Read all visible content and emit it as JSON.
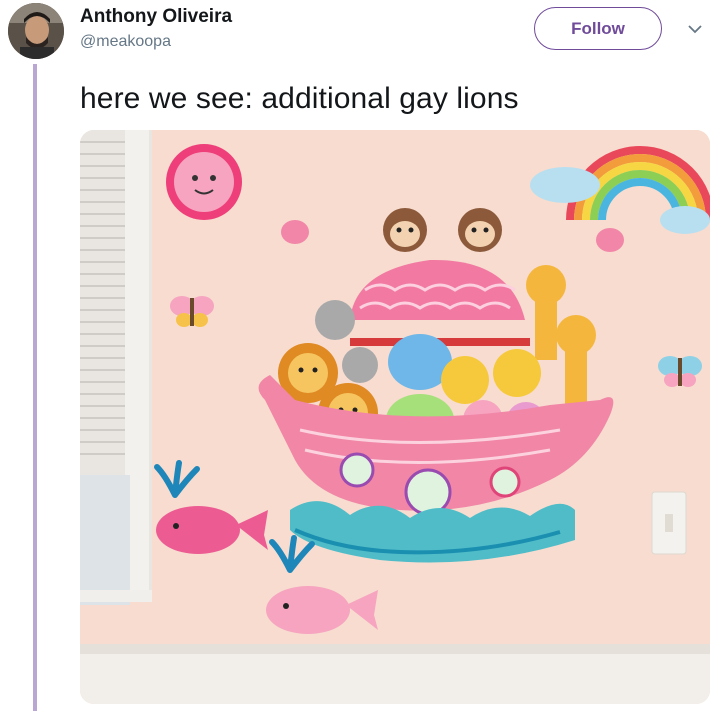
{
  "author": {
    "name": "Anthony Oliveira",
    "handle": "@meakoopa",
    "avatar_icon": "profile-photo"
  },
  "follow_button": {
    "label": "Follow"
  },
  "menu_icon": "chevron-down-icon",
  "tweet": {
    "text": "here we see: additional gay lions"
  },
  "media": {
    "description_icon": "noahs-ark-wall-decal-image"
  },
  "colors": {
    "accent": "#6f4b9a",
    "thread_line": "#b9a6d3",
    "text": "#14171a",
    "secondary": "#657786"
  }
}
